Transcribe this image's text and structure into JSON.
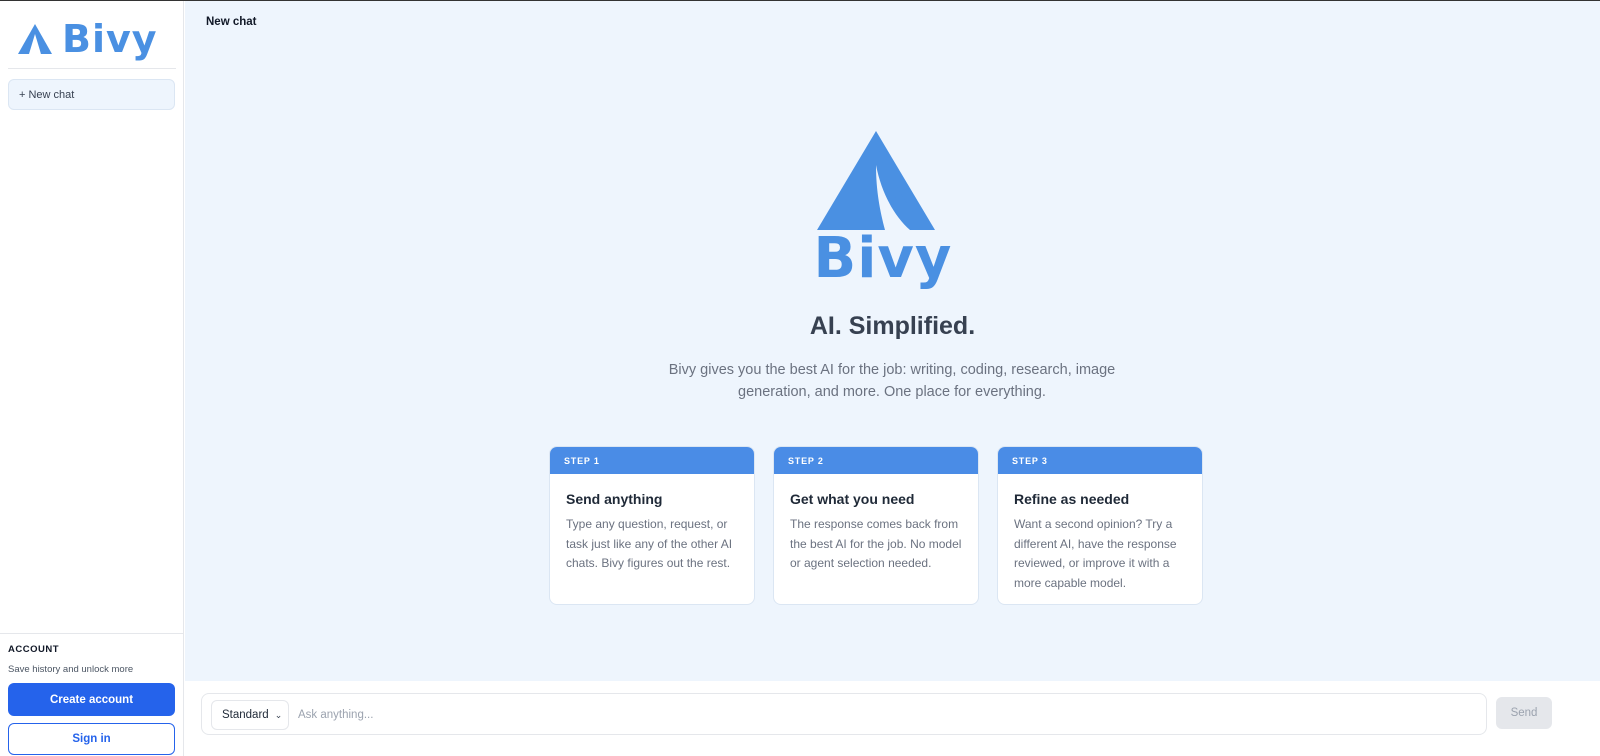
{
  "brand": {
    "name": "Bivy",
    "logo_icon": "tent-icon",
    "color": "#4a90e2"
  },
  "sidebar": {
    "new_chat_label": "+ New chat",
    "account": {
      "title": "ACCOUNT",
      "subtitle": "Save history and unlock more",
      "create_label": "Create account",
      "signin_label": "Sign in"
    }
  },
  "header": {
    "chat_title": "New chat"
  },
  "hero": {
    "logo_word": "Bivy",
    "tagline": "AI. Simplified.",
    "description": "Bivy gives you the best AI for the job: writing, coding, research, image generation, and more. One place for everything."
  },
  "steps": [
    {
      "label": "STEP 1",
      "title": "Send anything",
      "body": "Type any question, request, or task just like any of the other AI chats. Bivy figures out the rest."
    },
    {
      "label": "STEP 2",
      "title": "Get what you need",
      "body": "The response comes back from the best AI for the job. No model or agent selection needed."
    },
    {
      "label": "STEP 3",
      "title": "Refine as needed",
      "body": "Want a second opinion? Try a different AI, have the response reviewed, or improve it with a more capable model."
    }
  ],
  "composer": {
    "mode": "Standard",
    "placeholder": "Ask anything...",
    "send_label": "Send"
  },
  "colors": {
    "accent": "#2563eb",
    "step_header": "#4a8ce6",
    "main_bg": "#eef5fd"
  }
}
